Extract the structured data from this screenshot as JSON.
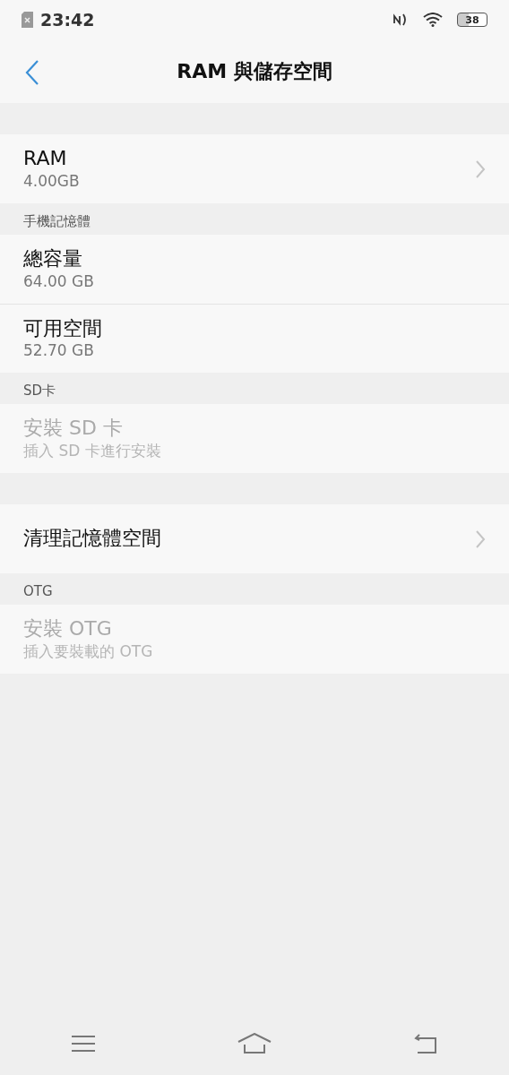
{
  "status_bar": {
    "time": "23:42",
    "battery": "38"
  },
  "header": {
    "title": "RAM 與儲存空間"
  },
  "sections": [
    {
      "items": [
        {
          "title": "RAM",
          "subtitle": "4.00GB",
          "disabled": false,
          "chevron": true
        }
      ]
    },
    {
      "header": "手機記憶體",
      "items": [
        {
          "title": "總容量",
          "subtitle": "64.00 GB",
          "disabled": false,
          "chevron": false
        },
        {
          "title": "可用空間",
          "subtitle": "52.70 GB",
          "disabled": false,
          "chevron": false
        }
      ]
    },
    {
      "header": "SD卡",
      "items": [
        {
          "title": "安裝 SD 卡",
          "subtitle": "插入 SD 卡進行安裝",
          "disabled": true,
          "chevron": false
        }
      ]
    },
    {
      "items": [
        {
          "title": "清理記憶體空間",
          "disabled": false,
          "chevron": true
        }
      ]
    },
    {
      "header": "OTG",
      "items": [
        {
          "title": "安裝 OTG",
          "subtitle": "插入要裝載的 OTG",
          "disabled": true,
          "chevron": false
        }
      ]
    }
  ]
}
